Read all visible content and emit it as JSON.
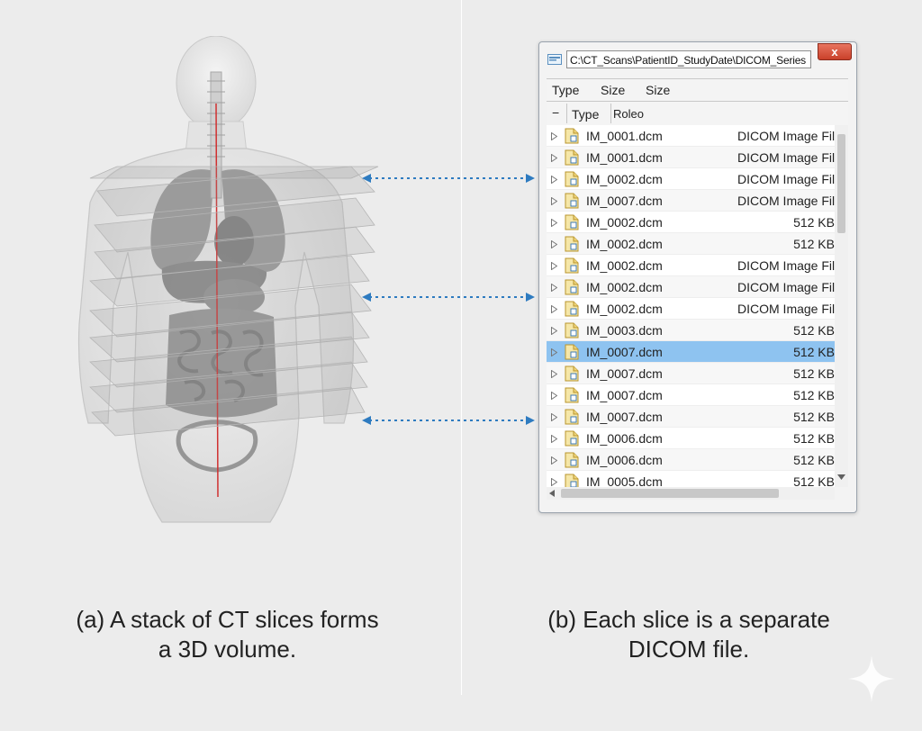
{
  "captions": {
    "a_line1": "(a) A stack of CT slices forms",
    "a_line2": "a 3D volume.",
    "b_line1": "(b) Each slice is a separate",
    "b_line2": "DICOM file."
  },
  "explorer": {
    "address": "C:\\CT_Scans\\PatientID_StudyDate\\DICOM_Series",
    "close_label": "x",
    "header_row_1": [
      "Type",
      "Size",
      "Size"
    ],
    "header_row_2": {
      "collapse": "−",
      "type": "Type",
      "role": "Roleo"
    },
    "files": [
      {
        "name": "IM_0001.dcm",
        "detail": "DICOM Image File"
      },
      {
        "name": "IM_0001.dcm",
        "detail": "DICOM Image File"
      },
      {
        "name": "IM_0002.dcm",
        "detail": "DICOM Image File"
      },
      {
        "name": "IM_0007.dcm",
        "detail": "DICOM Image File"
      },
      {
        "name": "IM_0002.dcm",
        "detail": "512 KB"
      },
      {
        "name": "IM_0002.dcm",
        "detail": "512 KB"
      },
      {
        "name": "IM_0002.dcm",
        "detail": "DICOM Image File"
      },
      {
        "name": "IM_0002.dcm",
        "detail": "DICOM Image File"
      },
      {
        "name": "IM_0002.dcm",
        "detail": "DICOM Image File"
      },
      {
        "name": "IM_0003.dcm",
        "detail": "512 KB"
      },
      {
        "name": "IM_0007.dcm",
        "detail": "512 KB",
        "selected": true
      },
      {
        "name": "IM_0007.dcm",
        "detail": "512 KB"
      },
      {
        "name": "IM_0007.dcm",
        "detail": "512 KB"
      },
      {
        "name": "IM_0007.dcm",
        "detail": "512 KB"
      },
      {
        "name": "IM_0006.dcm",
        "detail": "512 KB"
      },
      {
        "name": "IM_0006.dcm",
        "detail": "512 KB"
      },
      {
        "name": "IM_0005.dcm",
        "detail": "512 KB"
      }
    ]
  },
  "colors": {
    "arrow": "#2e7bc0",
    "selection": "#8ec3f0",
    "spine_line": "#d03030"
  },
  "icons": {
    "window": "folder-icon",
    "file": "dicom-file-icon",
    "expander": "triangle-right-icon",
    "close": "close-icon",
    "sparkle": "sparkle-icon"
  }
}
